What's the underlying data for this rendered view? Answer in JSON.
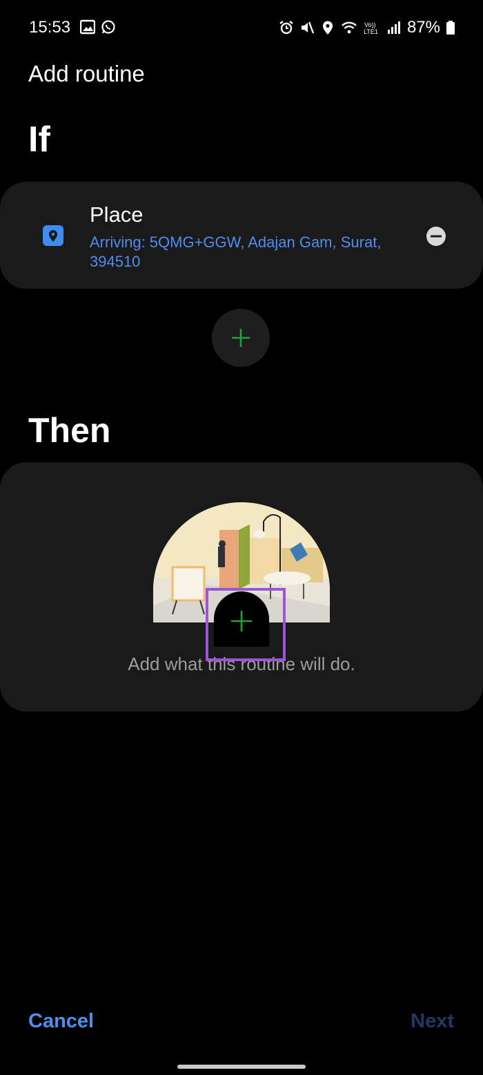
{
  "status_bar": {
    "time": "15:53",
    "battery": "87%",
    "left_icons": [
      "gallery-icon",
      "whatsapp-icon"
    ],
    "right_icons": [
      "alarm-icon",
      "mute-icon",
      "location-icon",
      "wifi-icon",
      "volte-icon",
      "signal-icon",
      "battery-icon"
    ]
  },
  "header": {
    "title": "Add routine"
  },
  "if_section": {
    "heading": "If",
    "condition": {
      "title": "Place",
      "detail": "Arriving: 5QMG+GGW, Adajan Gam, Surat,  394510",
      "icon": "location-pin-icon",
      "accent_color": "#4d8ef0"
    }
  },
  "then_section": {
    "heading": "Then",
    "empty_hint": "Add what this routine will do."
  },
  "footer": {
    "cancel_label": "Cancel",
    "next_label": "Next"
  },
  "colors": {
    "accent": "#4d8ef0",
    "plus": "#1fa43c",
    "highlight": "#9b55d6",
    "card": "#1a1a1a"
  }
}
